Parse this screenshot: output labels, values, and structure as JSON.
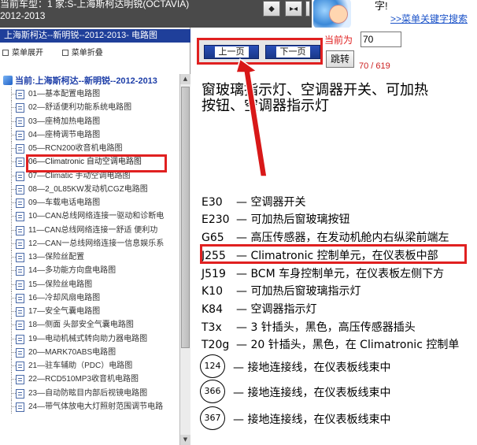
{
  "header": {
    "line1": "当前车型：1  家:S-上海斯柯达明锐(OCTAVIA)",
    "line2": "2012-2013",
    "toolbar": [
      {
        "name": "diamond-icon",
        "glyph": "◆"
      },
      {
        "name": "fit-width-icon",
        "glyph": "▸◂"
      },
      {
        "name": "toolbar-edge-icon",
        "glyph": ""
      }
    ],
    "promo": {
      "text": "字!",
      "link": ">>菜单关键字搜索"
    }
  },
  "left": {
    "title": "上海斯柯达--新明锐--2012-2013- 电路图",
    "menu": {
      "expand": "菜单展开",
      "collapse": "菜单折叠"
    },
    "tree_root": "当前:上海斯柯达--新明锐--2012-2013",
    "items": [
      "01—基本配置电路图",
      "02—舒适便利功能系统电路图",
      "03—座椅加热电路图",
      "04—座椅调节电路图",
      "05—RCN200收音机电路图",
      "06—Climatronic 自动空调电路图",
      "07—Climatic 手动空调电路图",
      "08—2_0L85KW发动机CGZ电路图",
      "09—车载电话电路图",
      "10—CAN总线网络连接一驱动和诊断电",
      "11—CAN总线网络连接一舒适 便利功",
      "12—CAN一总线网络连接一信息娱乐系",
      "13—保险丝配置",
      "14—多功能方向盘电路图",
      "15—保险丝电路图",
      "16—冷却风扇电路图",
      "17—安全气囊电路图",
      "18—侧面 头部安全气囊电路图",
      "19—电动机械式转向助力器电路图",
      "20—MARK70ABS电路图",
      "21—驻车辅助（PDC）电路图",
      "22—RCD510MP3收音机电路图",
      "23—自动防眩目内部后视镜电路图",
      "24—带气体放电大灯照射范围调节电路"
    ],
    "selected_index": 5
  },
  "nav": {
    "prev": "上一页",
    "next": "下一页",
    "page_label": "当前为",
    "page_value": "70",
    "jump": "跳转",
    "page_count": "70 / 619"
  },
  "doc": {
    "title_line1": "窗玻璃指示灯、空调器开关、可加热",
    "title_line2": "按钮、空调器指示灯",
    "legend": [
      {
        "code": "E30",
        "desc": "— 空调器开关"
      },
      {
        "code": "E230",
        "desc": "— 可加热后窗玻璃按钮"
      },
      {
        "code": "G65",
        "desc": "— 高压传感器，在发动机舱内右纵梁前端左"
      },
      {
        "code": "J255",
        "desc": "— Climatronic 控制单元，在仪表板中部"
      },
      {
        "code": "J519",
        "desc": "— BCM 车身控制单元，在仪表板左侧下方"
      },
      {
        "code": "K10",
        "desc": "— 可加热后窗玻璃指示灯"
      },
      {
        "code": "K84",
        "desc": "— 空调器指示灯"
      },
      {
        "code": "T3x",
        "desc": "— 3 针插头，黑色，高压传感器插头"
      },
      {
        "code": "T20g",
        "desc": "— 20 针插头，黑色，在 Climatronic 控制单"
      }
    ],
    "grounds": [
      {
        "num": "124",
        "desc": "— 接地连接线，在仪表板线束中"
      },
      {
        "num": "366",
        "desc": "— 接地连接线，在仪表板线束中"
      },
      {
        "num": "367",
        "desc": "— 接地连接线，在仪表板线束中"
      }
    ]
  },
  "colors": {
    "highlight": "#e02020",
    "nav_blue": "#1f3f9a"
  }
}
